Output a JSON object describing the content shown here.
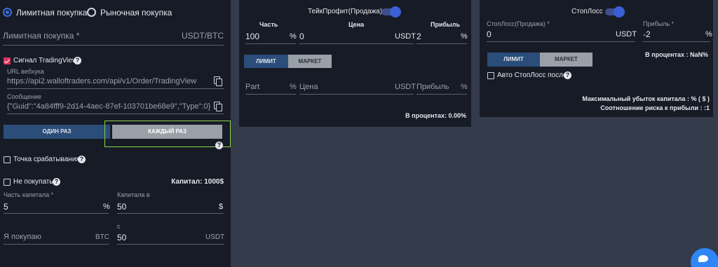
{
  "left": {
    "order_type": {
      "limit_label": "Лимитная покупка",
      "market_label": "Рыночная покупка"
    },
    "limit_buy": {
      "label": "Лимитная покупка *",
      "unit": "USDT/BTC"
    },
    "tv_signal": {
      "label": "Сигнал TradingView",
      "webhook_label": "URL вебхука",
      "webhook_value": "https://api2.walloftraders.com/api/v1/Order/TradingView",
      "message_label": "Сообщение",
      "message_value": "{\"Guid\":\"4a84fff9-2d14-4aec-87ef-103701be68e9\",\"Type\":0}"
    },
    "frequency": {
      "once_label": "ОДИН РАЗ",
      "every_label": "КАЖДЫЙ РАЗ"
    },
    "trigger_point_label": "Точка срабатывания",
    "dont_buy_label": "Не покупать",
    "capital_label": "Капитал: 1000$",
    "capital_part": {
      "label": "Часть капитала *",
      "value": "5",
      "unit": "%"
    },
    "capital_in": {
      "label": "Капитала в",
      "value": "50",
      "unit": "$"
    },
    "i_buy": {
      "label": "Я покупаю",
      "unit": "BTC"
    },
    "c_field": {
      "label": "с",
      "value": "50",
      "unit": "USDT"
    }
  },
  "take_profit": {
    "title": "ТейкПрофит(Продажа)",
    "col_part": "Часть",
    "col_price": "Цена",
    "col_profit": "Прибыль",
    "row1": {
      "part": "100",
      "part_unit": "%",
      "price": "0",
      "price_unit": "USDT",
      "profit": "2",
      "profit_unit": "%"
    },
    "limit_btn": "ЛИМИТ",
    "market_btn": "МАРКЕТ",
    "row2": {
      "part_ph": "Part",
      "part_unit": "%",
      "price_ph": "Цена",
      "price_unit": "USDT",
      "profit_ph": "Прибыль",
      "profit_unit": "%"
    },
    "percent_text": "В процентах: 0.00%"
  },
  "stop_loss": {
    "title": "СтопЛосс",
    "sl_label": "СтопЛосс(Продажа) *",
    "sl_value": "0",
    "sl_unit": "USDT",
    "profit_label": "Прибыль *",
    "profit_value": "-2",
    "profit_unit": "%",
    "percent_text": "В процентах : NaN%",
    "limit_btn": "ЛИМИТ",
    "market_btn": "МАРКЕТ",
    "auto_label": "Авто СтопЛосс после",
    "max_loss_text": "Максимальный убыток капитала : % ( $ )",
    "risk_ratio_text": "Соотношение риска к прибыли : :1"
  },
  "colors": {
    "accent": "#3d6de0",
    "checkbox_on": "#e0315e",
    "chat": "#2f86f6",
    "highlight": "#8bd34d"
  }
}
